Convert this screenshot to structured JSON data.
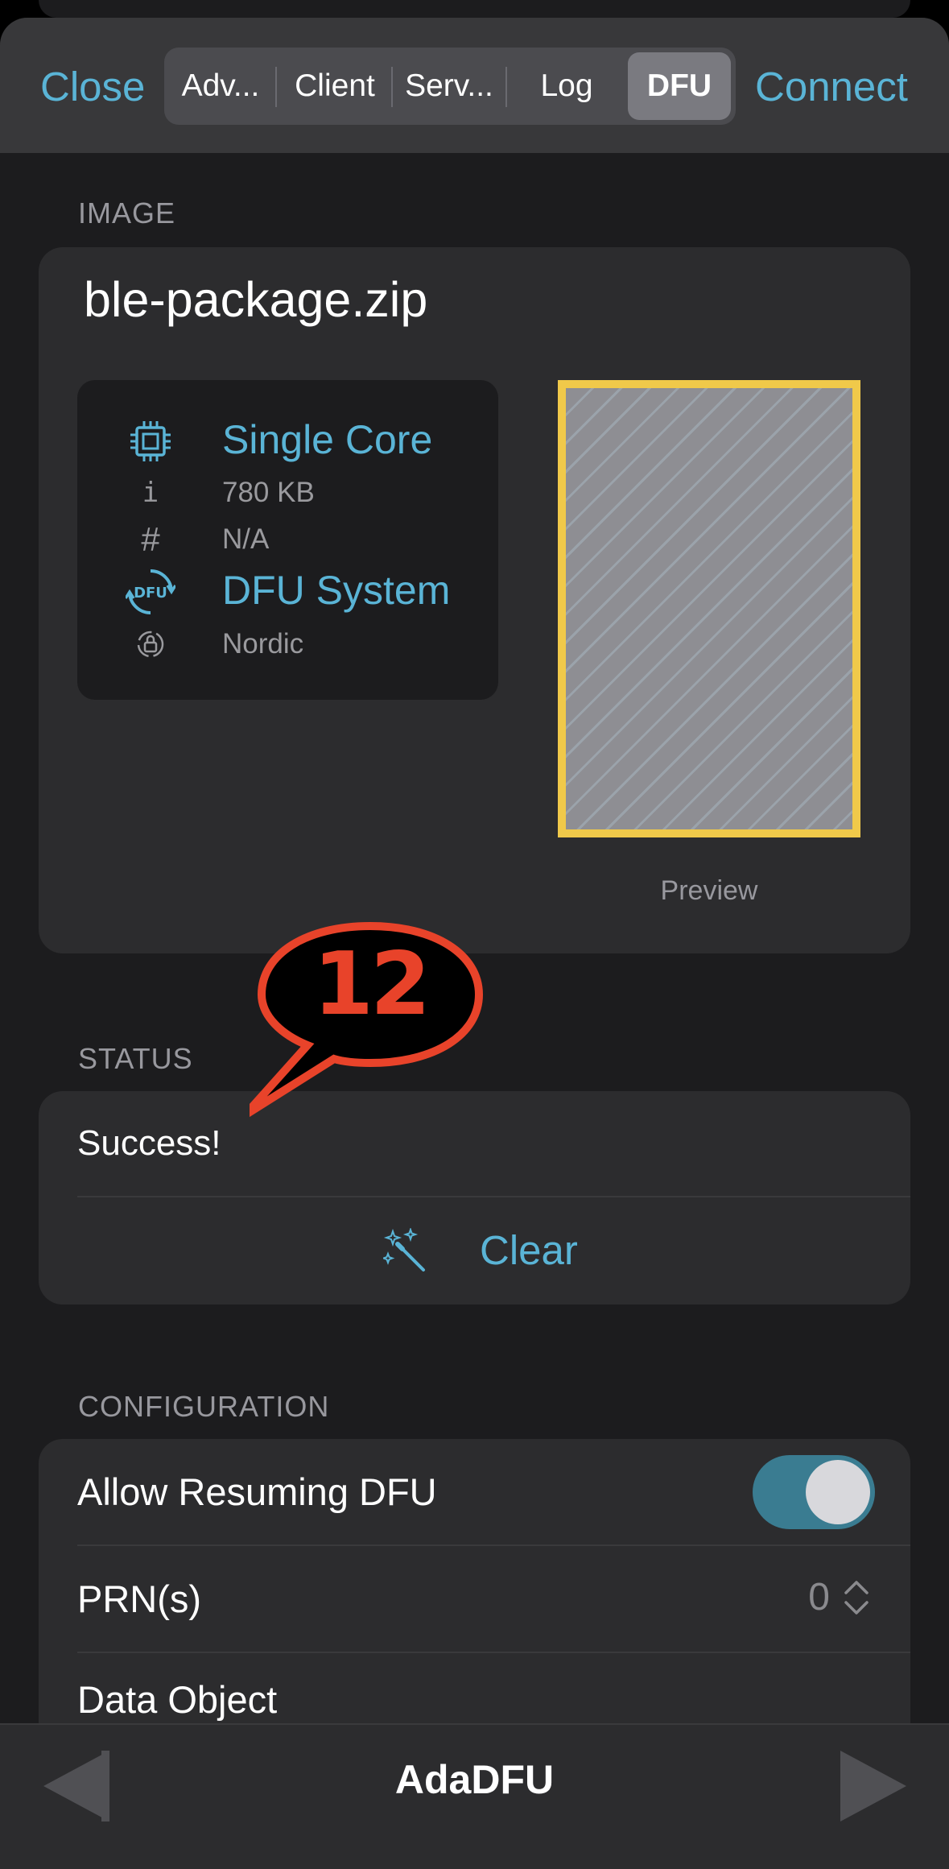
{
  "nav": {
    "close_label": "Close",
    "connect_label": "Connect",
    "tabs": [
      {
        "label": "Adv..."
      },
      {
        "label": "Client"
      },
      {
        "label": "Serv..."
      },
      {
        "label": "Log"
      },
      {
        "label": "DFU",
        "selected": true
      }
    ]
  },
  "image_section": {
    "label": "IMAGE",
    "file_name": "ble-package.zip",
    "info": {
      "core": "Single Core",
      "size_icon": "i",
      "size": "780 KB",
      "hash_icon": "#",
      "hash": "N/A",
      "dfu_icon_text": "DFU",
      "dfu_system": "DFU System",
      "vendor": "Nordic"
    },
    "preview_label": "Preview"
  },
  "status_section": {
    "label": "STATUS",
    "status_text": "Success!",
    "clear_label": "Clear"
  },
  "configuration": {
    "label": "CONFIGURATION",
    "allow_resuming_label": "Allow Resuming DFU",
    "allow_resuming_on": true,
    "prn_label": "PRN(s)",
    "prn_value": "0",
    "data_object_label": "Data Object"
  },
  "toolbar": {
    "title": "AdaDFU"
  },
  "annotation": {
    "number": "12"
  },
  "colors": {
    "accent": "#5ab4d6",
    "toggle_on": "#3a7c91",
    "preview_border": "#f0c94a",
    "callout": "#e8432a"
  },
  "icons": [
    "chip-icon",
    "info-icon",
    "hash-icon",
    "dfu-icon",
    "vendor-icon",
    "magic-wand-icon",
    "chevron-updown-icon",
    "back-arrow-icon",
    "forward-arrow-icon"
  ]
}
